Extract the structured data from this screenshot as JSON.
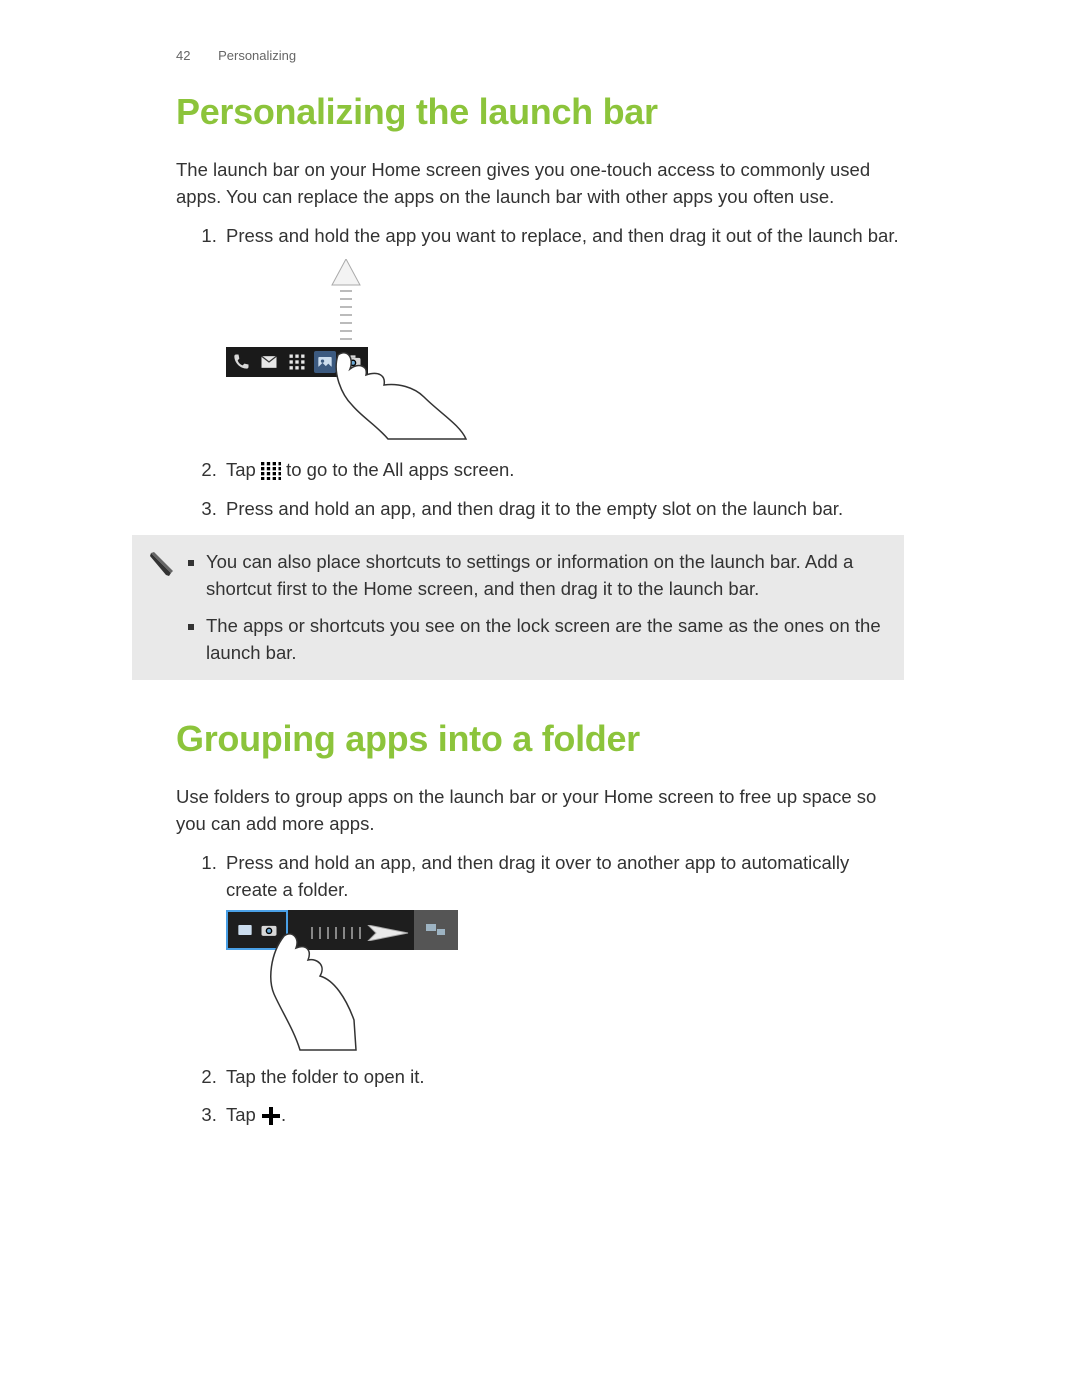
{
  "header": {
    "page_number": "42",
    "section_label": "Personalizing"
  },
  "section1": {
    "title": "Personalizing the launch bar",
    "intro": "The launch bar on your Home screen gives you one-touch access to commonly used apps. You can replace the apps on the launch bar with other apps you often use.",
    "step1": "Press and hold the app you want to replace, and then drag it out of the launch bar.",
    "step2_pre": "Tap ",
    "step2_post": " to go to the All apps screen.",
    "step3": "Press and hold an app, and then drag it to the empty slot on the launch bar.",
    "note_bullet1": "You can also place shortcuts to settings or information on the launch bar. Add a shortcut first to the Home screen, and then drag it to the launch bar.",
    "note_bullet2": "The apps or shortcuts you see on the lock screen are the same as the ones on the launch bar."
  },
  "section2": {
    "title": "Grouping apps into a folder",
    "intro": "Use folders to group apps on the launch bar or your Home screen to free up space so you can add more apps.",
    "step1": "Press and hold an app, and then drag it over to another app to automatically create a folder.",
    "step2": "Tap the folder to open it.",
    "step3_pre": "Tap ",
    "step3_post": "."
  }
}
